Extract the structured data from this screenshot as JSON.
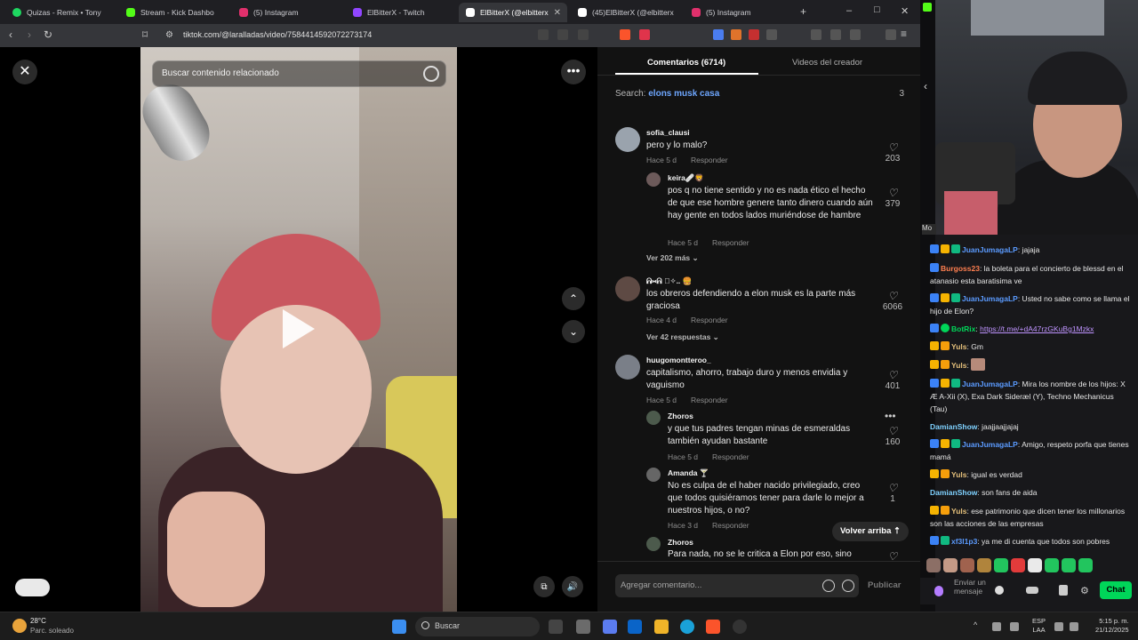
{
  "browser": {
    "tabs": [
      {
        "label": "Quizas - Remix • Tony",
        "color": "#1ed760"
      },
      {
        "label": "Stream - Kick Dashbo",
        "color": "#53fc18"
      },
      {
        "label": "(5) Instagram",
        "color": "#e1306c"
      },
      {
        "label": "ElBitterX - Twitch",
        "color": "#9146ff"
      },
      {
        "label": "ElBitterX (@elbitterx",
        "color": "#ffffff"
      },
      {
        "label": "(45)ElBitterX (@elbitterx",
        "color": "#ffffff"
      },
      {
        "label": "(5) Instagram",
        "color": "#e1306c"
      }
    ],
    "new_tab": "+",
    "url": "tiktok.com/@laralladas/video/7584414592072273174",
    "window_controls": {
      "minimize": "–",
      "maximize": "□",
      "close": "✕"
    }
  },
  "video": {
    "search_placeholder": "Buscar contenido relacionado",
    "close": "✕",
    "more": "•••",
    "up": "⌃",
    "down": "⌄"
  },
  "comments": {
    "tab_comments": "Comentarios (6714)",
    "tab_creator_videos": "Videos del creador",
    "search_prefix": "Search: ",
    "search_query": "elons musk casa",
    "search_count": "3",
    "reply_label": "Responder",
    "items": [
      {
        "user": "sofia_clausi",
        "text": "pero y lo malo?",
        "time": "Hace 5 d",
        "likes": "203"
      },
      {
        "user": "keira🩹🦁",
        "text": "pos q no tiene sentido y no es nada ético el hecho de que ese hombre genere tanto dinero cuando aún hay gente en todos lados muriéndose de hambre",
        "time": "Hace 5 d",
        "likes": "379"
      },
      {
        "user": "ᕱ⑅ᕱ ゚✧.. 🍔",
        "text": "los obreros defendiendo a elon musk es la parte más graciosa",
        "time": "Hace 4 d",
        "likes": "6066"
      },
      {
        "user": "huugomontteroo_",
        "text": "capitalismo, ahorro, trabajo duro y menos envidia y vaguismo",
        "time": "Hace 5 d",
        "likes": "401"
      },
      {
        "user": "Zhoros",
        "text": "y que tus padres tengan minas de esmeraldas también ayudan bastante",
        "time": "Hace 5 d",
        "likes": "160"
      },
      {
        "user": "Amanda 🍸",
        "text": "No es culpa de el haber nacido privilegiado, creo que todos quisiéramos tener para darle lo mejor a nuestros hijos, o no?",
        "time": "Hace 3 d",
        "likes": "1"
      },
      {
        "user": "Zhoros",
        "text": "Para nada, no se le critica a Elon por eso, sino",
        "time": "",
        "likes": ""
      }
    ],
    "more_replies_1": "Ver 202 más",
    "more_replies_2": "Ver 42 respuestas",
    "back_to_top": "Volver arriba",
    "add_comment_placeholder": "Agregar comentario...",
    "publish": "Publicar"
  },
  "chat": {
    "messages": [
      {
        "user": "JuanJumagaLP",
        "color": "#5b9bff",
        "text": ": jajaja"
      },
      {
        "user": "Burgoss23",
        "color": "#ff7f50",
        "text": ": la boleta para el concierto de blessd en el atanasio esta baratisima ve"
      },
      {
        "user": "JuanJumagaLP",
        "color": "#5b9bff",
        "text": ": Usted no sabe como se llama el hijo de Elon?"
      },
      {
        "user": "BotRix",
        "color": "#00d659",
        "text": ": ",
        "link": "https://t.me/+dA47rzGKuBg1Mzkx"
      },
      {
        "user": "Yuls",
        "color": "#e5c07b",
        "text": ": Gm"
      },
      {
        "user": "Yuls",
        "color": "#e5c07b",
        "text": ": "
      },
      {
        "user": "JuanJumagaLP",
        "color": "#5b9bff",
        "text": ": Mira los nombre de los hijos: X Æ A-Xii (X), Exa Dark Sideræl (Y), Techno Mechanicus (Tau)"
      },
      {
        "user": "DamianShow",
        "color": "#7fd1ff",
        "text": ": jaajjaajjajaj"
      },
      {
        "user": "JuanJumagaLP",
        "color": "#5b9bff",
        "text": ": Amigo, respeto porfa que tienes mamá"
      },
      {
        "user": "Yuls",
        "color": "#e5c07b",
        "text": ": igual es verdad"
      },
      {
        "user": "DamianShow",
        "color": "#7fd1ff",
        "text": ": son fans de aida"
      },
      {
        "user": "Yuls",
        "color": "#e5c07b",
        "text": ": ese patrimonio que dicen tener los millonarios son las acciones de las empresas"
      },
      {
        "user": "xf3l1p3",
        "color": "#5b9bff",
        "text": ": ya me di cuenta que todos son pobres"
      }
    ],
    "send_placeholder": "Enviar un mensaje",
    "chat_button": "Chat",
    "mod_label": "Mo"
  },
  "taskbar": {
    "temp": "28°C",
    "weather": "Parc. soleado",
    "search": "Buscar",
    "lang1": "ESP",
    "lang2": "LAA",
    "time": "5:15 p. m.",
    "date": "21/12/2025"
  }
}
